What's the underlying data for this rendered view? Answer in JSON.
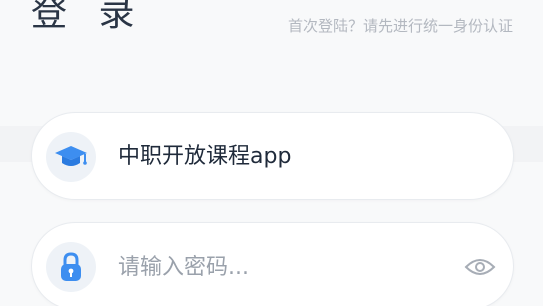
{
  "header": {
    "title": "登 录",
    "hint": "首次登陆？请先进行统一身份认证"
  },
  "school": {
    "name": "中职开放课程app",
    "icon": "graduation-cap-icon"
  },
  "password": {
    "placeholder": "请输入密码...",
    "value": "",
    "icon": "lock-icon",
    "toggle_icon": "eye-icon"
  },
  "colors": {
    "accent": "#3d8ef0",
    "icon_bg": "#eef2f7",
    "hint": "#b3b8c0"
  }
}
